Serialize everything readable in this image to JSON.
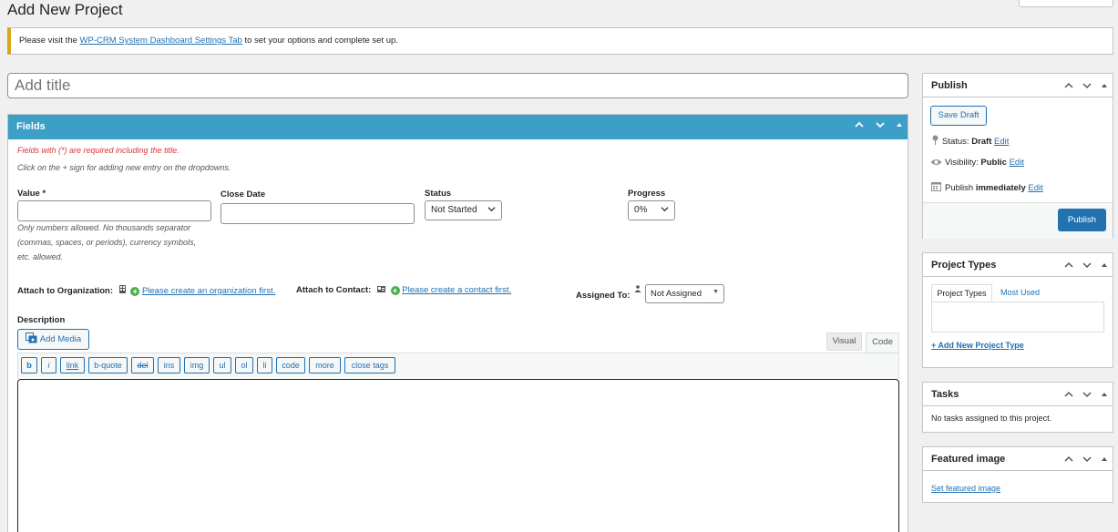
{
  "page": {
    "title": "Add New Project"
  },
  "notice": {
    "prefix": "Please visit the ",
    "link": "WP-CRM System Dashboard Settings Tab",
    "suffix": " to set your options and complete set up."
  },
  "title_input": {
    "placeholder": "Add title"
  },
  "fields": {
    "heading": "Fields",
    "required_note": "Fields with (*) are required including the title.",
    "plus_note": "Click on the + sign for adding new entry on the dropdowns.",
    "value_label": "Value *",
    "value_note": [
      "Only numbers allowed. No thousands separator",
      "(commas, spaces, or periods), currency symbols,",
      "etc. allowed."
    ],
    "close_date_label": "Close Date",
    "status_label": "Status",
    "status_value": "Not Started",
    "progress_label": "Progress",
    "progress_value": "0%",
    "attach_org_label": "Attach to Organization:",
    "attach_org_link": "Please create an organization first.",
    "attach_contact_label": "Attach to Contact:",
    "attach_contact_link": "Please create a contact first.",
    "assigned_label": "Assigned To:",
    "assigned_value": "Not Assigned",
    "description_label": "Description",
    "add_media": "Add Media",
    "tab_visual": "Visual",
    "tab_code": "Code",
    "quicktags": [
      "b",
      "i",
      "link",
      "b-quote",
      "del",
      "ins",
      "img",
      "ul",
      "ol",
      "li",
      "code",
      "more",
      "close tags"
    ]
  },
  "publish": {
    "heading": "Publish",
    "save_draft": "Save Draft",
    "status_label": "Status: ",
    "status_value": "Draft",
    "visibility_label": "Visibility: ",
    "visibility_value": "Public",
    "publish_label": "Publish ",
    "publish_value": "immediately",
    "edit": "Edit",
    "publish_button": "Publish"
  },
  "project_types": {
    "heading": "Project Types",
    "tab_all": "Project Types",
    "tab_most_used": "Most Used",
    "add_link": "+ Add New Project Type"
  },
  "tasks": {
    "heading": "Tasks",
    "empty": "No tasks assigned to this project."
  },
  "featured_image": {
    "heading": "Featured image",
    "link": "Set featured image"
  },
  "colors": {
    "accent": "#3c9fc8",
    "link": "#2271b1",
    "required": "#d63638",
    "notice_border": "#dba617"
  }
}
